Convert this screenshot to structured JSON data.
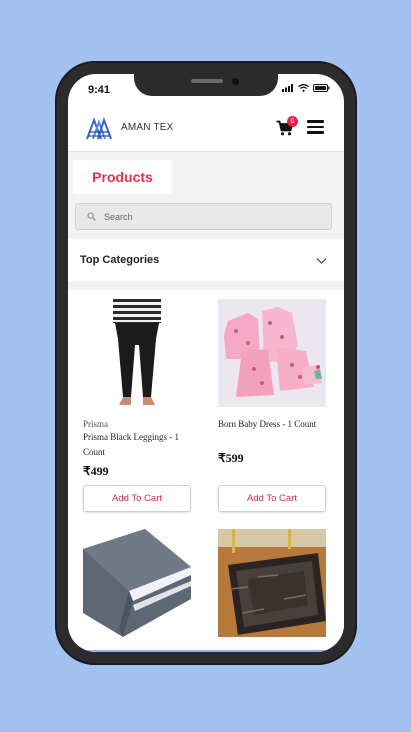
{
  "status_bar": {
    "time": "9:41",
    "icons": [
      "signal-icon",
      "wifi-icon",
      "battery-icon"
    ]
  },
  "header": {
    "brand_name": "AMAN TEX",
    "cart_count": "0",
    "icons": [
      "logo-icon",
      "cart-icon",
      "menu-icon"
    ]
  },
  "page": {
    "title": "Products"
  },
  "search": {
    "placeholder": "Search"
  },
  "categories": {
    "label": "Top Categories"
  },
  "products": [
    {
      "brand": "Prisma",
      "name": "Prisma Black Leggings - 1 Count",
      "price": "₹499",
      "button": "Add To Cart"
    },
    {
      "brand": "",
      "name": "Born Baby Dress - 1 Count",
      "price": "₹599",
      "button": "Add To Cart"
    },
    {
      "brand": "",
      "name": "",
      "price": "",
      "button": ""
    },
    {
      "brand": "",
      "name": "",
      "price": "",
      "button": ""
    }
  ],
  "colors": {
    "background": "#a4c2f1",
    "accent": "#e2314f",
    "badge": "#e02244"
  }
}
